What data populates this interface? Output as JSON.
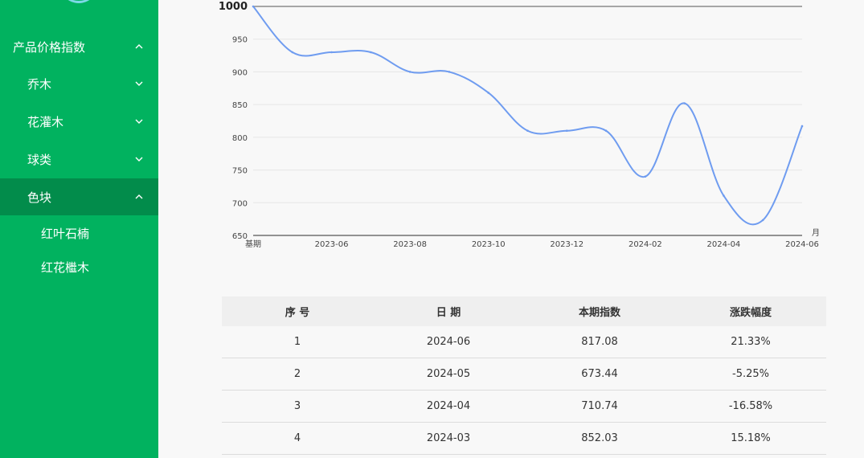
{
  "sidebar": {
    "section": {
      "label": "产品价格指数"
    },
    "items": [
      {
        "label": "乔木"
      },
      {
        "label": "花灌木"
      },
      {
        "label": "球类"
      },
      {
        "label": "色块"
      }
    ],
    "subitems": [
      {
        "label": "红叶石楠"
      },
      {
        "label": "红花檵木"
      }
    ]
  },
  "chart_data": {
    "type": "line",
    "x": [
      "基期",
      "2023-05",
      "2023-06",
      "2023-07",
      "2023-08",
      "2023-09",
      "2023-10",
      "2023-11",
      "2023-12",
      "2024-01",
      "2024-02",
      "2024-03",
      "2024-04",
      "2024-05",
      "2024-06"
    ],
    "xticks": [
      "基期",
      "2023-06",
      "2023-08",
      "2023-10",
      "2023-12",
      "2024-02",
      "2024-04",
      "2024-06"
    ],
    "xunit": "月",
    "series": [
      {
        "values": [
          1000,
          930,
          930,
          930,
          900,
          900,
          868,
          810,
          810,
          810,
          740,
          852.03,
          710.74,
          673.44,
          817.08
        ]
      }
    ],
    "ylim": [
      650,
      1000
    ],
    "yticks": [
      650,
      700,
      750,
      800,
      850,
      900,
      950,
      1000
    ],
    "line_color": "#6f9cf0",
    "grid": true
  },
  "table": {
    "headers": [
      "序 号",
      "日 期",
      "本期指数",
      "涨跌幅度"
    ],
    "rows": [
      [
        "1",
        "2024-06",
        "817.08",
        "21.33%"
      ],
      [
        "2",
        "2024-05",
        "673.44",
        "-5.25%"
      ],
      [
        "3",
        "2024-04",
        "710.74",
        "-16.58%"
      ],
      [
        "4",
        "2024-03",
        "852.03",
        "15.18%"
      ]
    ]
  }
}
